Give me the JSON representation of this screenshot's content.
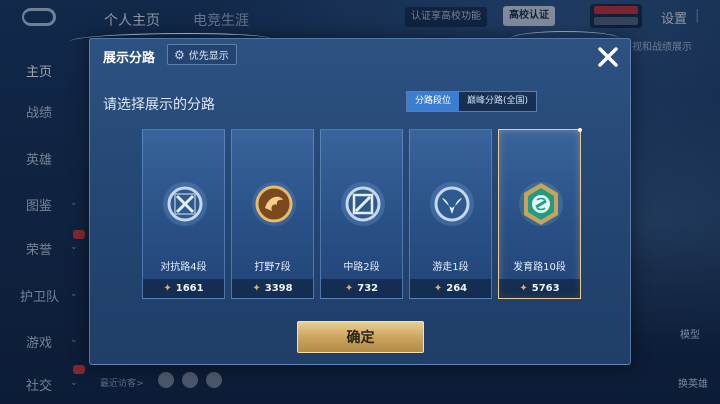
{
  "background": {
    "top_tabs": [
      "个人主页",
      "电竞生涯"
    ],
    "verify_pill": "认证享高校功能",
    "campus_button": "高校认证",
    "settings": "设置",
    "right_peek": "视和战绩展示",
    "sidebar": [
      "主页",
      "战绩",
      "英雄",
      "图鉴",
      "荣誉",
      "护卫队",
      "游戏",
      "社交"
    ],
    "bottom_peek": "最近访客>",
    "right_actions": [
      "模型",
      "换英雄"
    ]
  },
  "modal": {
    "title": "展示分路",
    "priority_label": "优先显示",
    "subtitle": "请选择展示的分路",
    "toggle": [
      "分路段位",
      "巅峰分路(全国)"
    ],
    "toggle_selected": 0,
    "cards": [
      {
        "role": "对抗路4段",
        "score": "1661",
        "emblem": "clash-lane-emblem-icon",
        "color": "#9fb9d6",
        "selected": false
      },
      {
        "role": "打野7段",
        "score": "3398",
        "emblem": "jungle-emblem-icon",
        "color": "#d9a85a",
        "selected": false
      },
      {
        "role": "中路2段",
        "score": "732",
        "emblem": "mid-lane-emblem-icon",
        "color": "#9fb9d6",
        "selected": false
      },
      {
        "role": "游走1段",
        "score": "264",
        "emblem": "roam-emblem-icon",
        "color": "#9fb9d6",
        "selected": false
      },
      {
        "role": "发育路10段",
        "score": "5763",
        "emblem": "farm-lane-emblem-icon",
        "color": "#2fb89a",
        "selected": true
      }
    ],
    "confirm_label": "确定"
  }
}
